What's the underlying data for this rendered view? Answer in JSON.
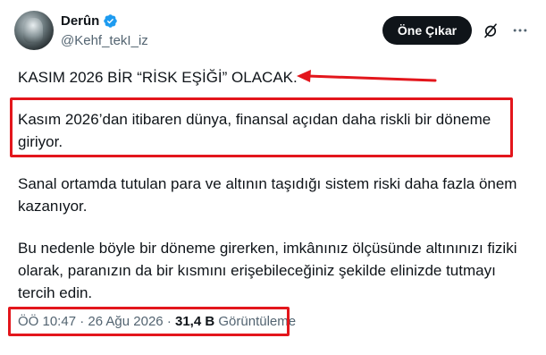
{
  "author": {
    "display_name": "Derûn",
    "handle": "@Kehf_tekI_iz",
    "verified": true,
    "avatar_icon": "avatar-image",
    "verified_color": "#1d9bf0"
  },
  "actions": {
    "promote_label": "Öne Çıkar",
    "grok_icon": "grok-icon",
    "more_icon": "more-icon"
  },
  "tweet": {
    "paragraphs": [
      "KASIM 2026 BİR “RİSK EŞİĞİ” OLACAK.",
      "Kasım 2026’dan itibaren dünya, finansal açıdan daha riskli bir döneme giriyor.",
      "Sanal ortamda tutulan para ve altının taşıdığı sistem riski daha fazla önem kazanıyor.",
      "Bu nedenle böyle bir döneme girerken, imkânınız ölçüsünde altınınızı fiziki olarak, paranızın da bir kısmını erişebileceğiniz şekilde elinizde tutmayı tercih edin."
    ]
  },
  "meta": {
    "time": "ÖÖ 10:47",
    "separator": " · ",
    "date": "26 Ağu 2026",
    "views_count": "31,4 B",
    "views_label": "Görüntüleme"
  },
  "annotations": {
    "highlight_color": "#e3161c"
  }
}
